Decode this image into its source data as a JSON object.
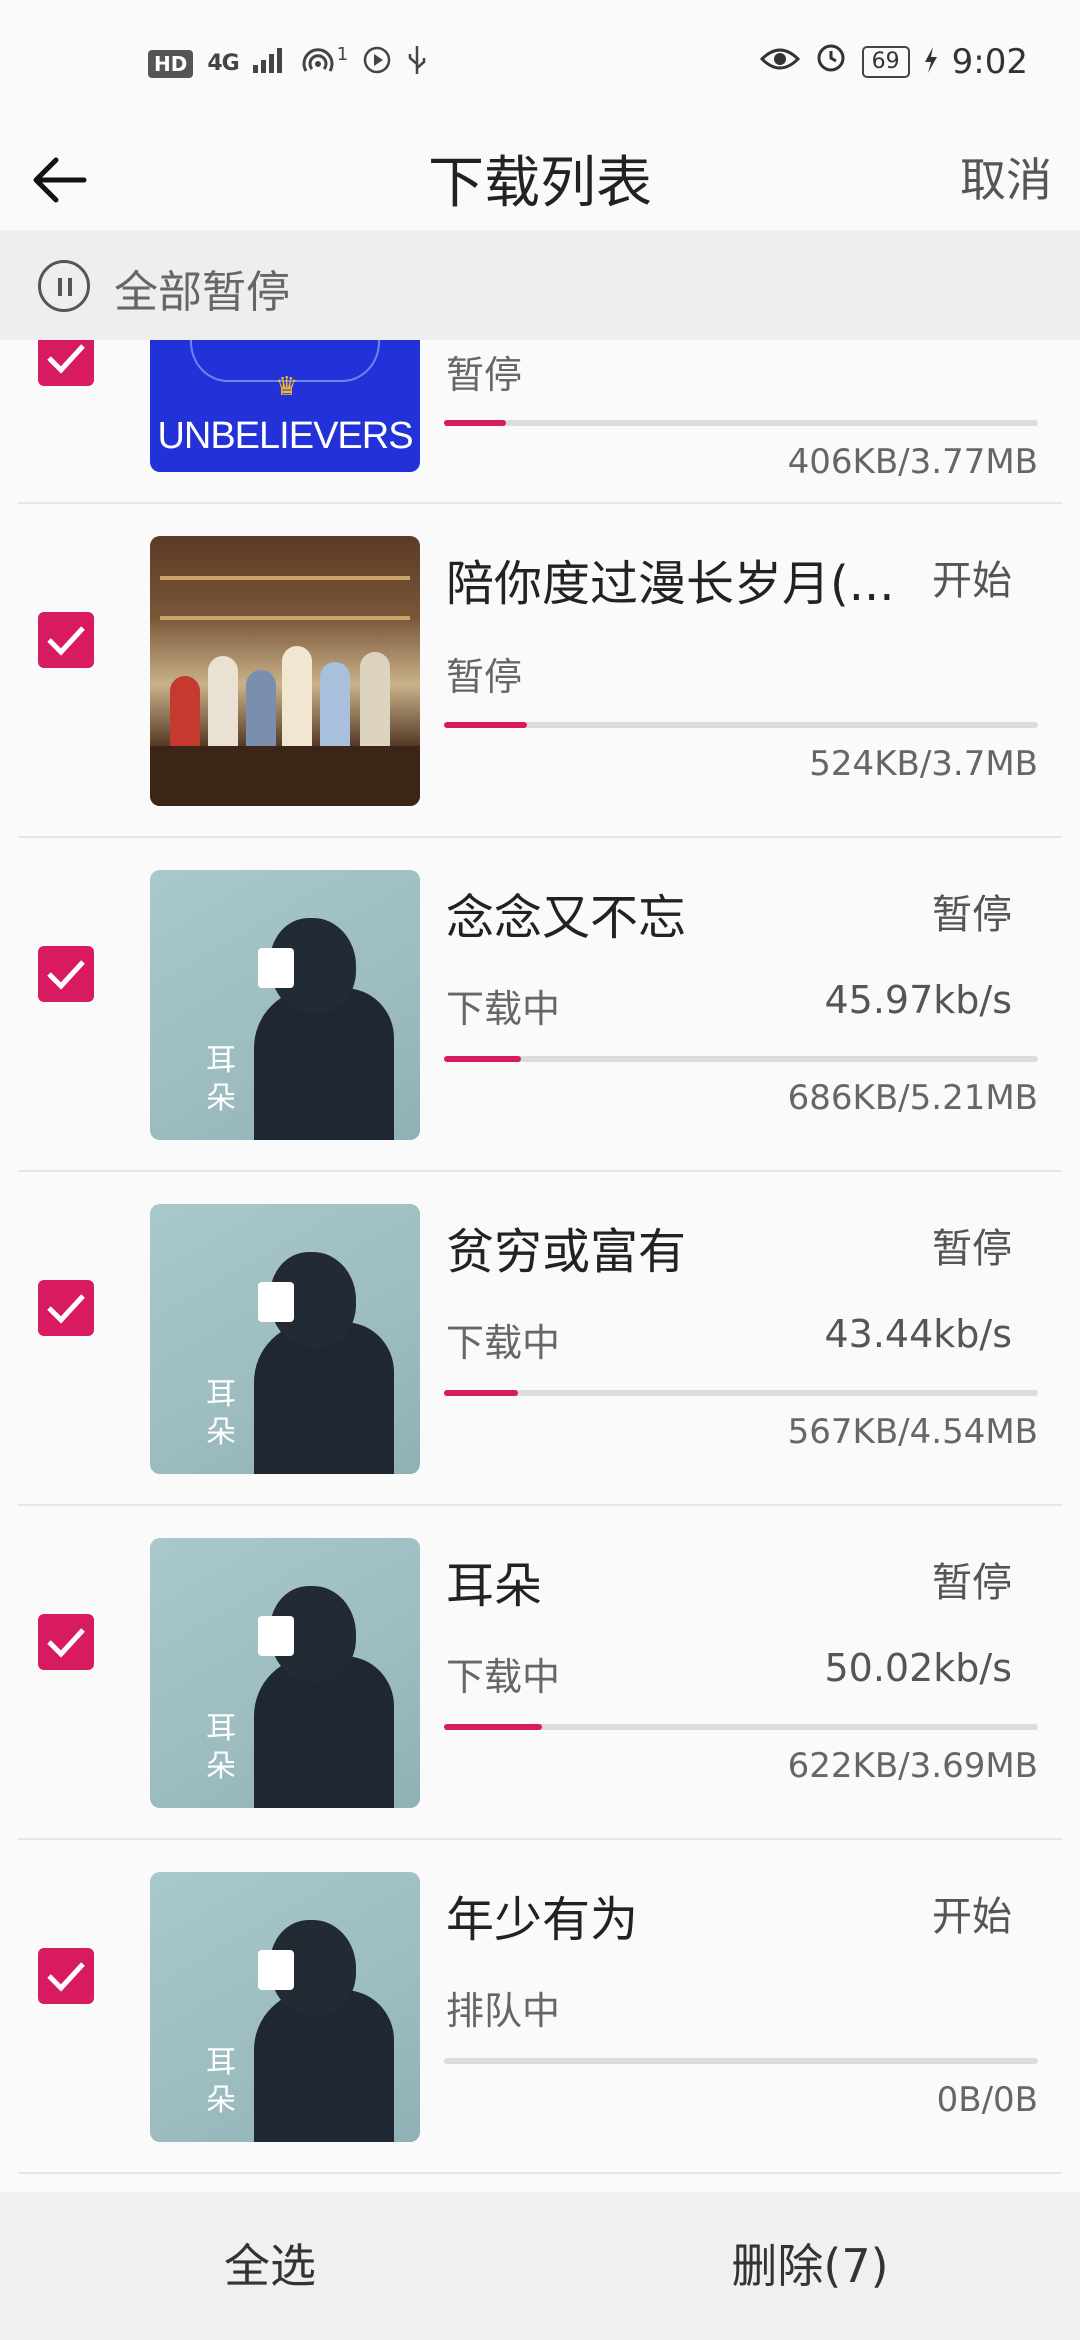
{
  "status_bar": {
    "left_icons": [
      "HD",
      "4G",
      "signal-icon",
      "hotspot-icon",
      "1",
      "play-icon",
      "usb-icon"
    ],
    "battery": "69",
    "time": "9:02"
  },
  "header": {
    "title": "下载列表",
    "cancel": "取消"
  },
  "pause_all": {
    "label": "全部暂停"
  },
  "items": [
    {
      "name": "",
      "action": "",
      "state": "暂停",
      "speed": "",
      "size": "406KB/3.77MB",
      "progress": 0.105,
      "cover": "unbelievers",
      "cover_text": "UNBELIEVERS"
    },
    {
      "name": "陪你度过漫长岁月(...",
      "action": "开始",
      "state": "暂停",
      "speed": "",
      "size": "524KB/3.7MB",
      "progress": 0.14,
      "cover": "family"
    },
    {
      "name": "念念又不忘",
      "action": "暂停",
      "state": "下载中",
      "speed": "45.97kb/s",
      "size": "686KB/5.21MB",
      "progress": 0.13,
      "cover": "ear",
      "cover_text": "耳朵"
    },
    {
      "name": "贫穷或富有",
      "action": "暂停",
      "state": "下载中",
      "speed": "43.44kb/s",
      "size": "567KB/4.54MB",
      "progress": 0.125,
      "cover": "ear",
      "cover_text": "耳朵"
    },
    {
      "name": "耳朵",
      "action": "暂停",
      "state": "下载中",
      "speed": "50.02kb/s",
      "size": "622KB/3.69MB",
      "progress": 0.165,
      "cover": "ear",
      "cover_text": "耳朵"
    },
    {
      "name": "年少有为",
      "action": "开始",
      "state": "排队中",
      "speed": "",
      "size": "0B/0B",
      "progress": 0,
      "cover": "ear",
      "cover_text": "耳朵"
    }
  ],
  "bottom_bar": {
    "select_all": "全选",
    "delete": "删除(7)"
  },
  "colors": {
    "accent": "#d81b60",
    "track": "#dcdcdc"
  }
}
